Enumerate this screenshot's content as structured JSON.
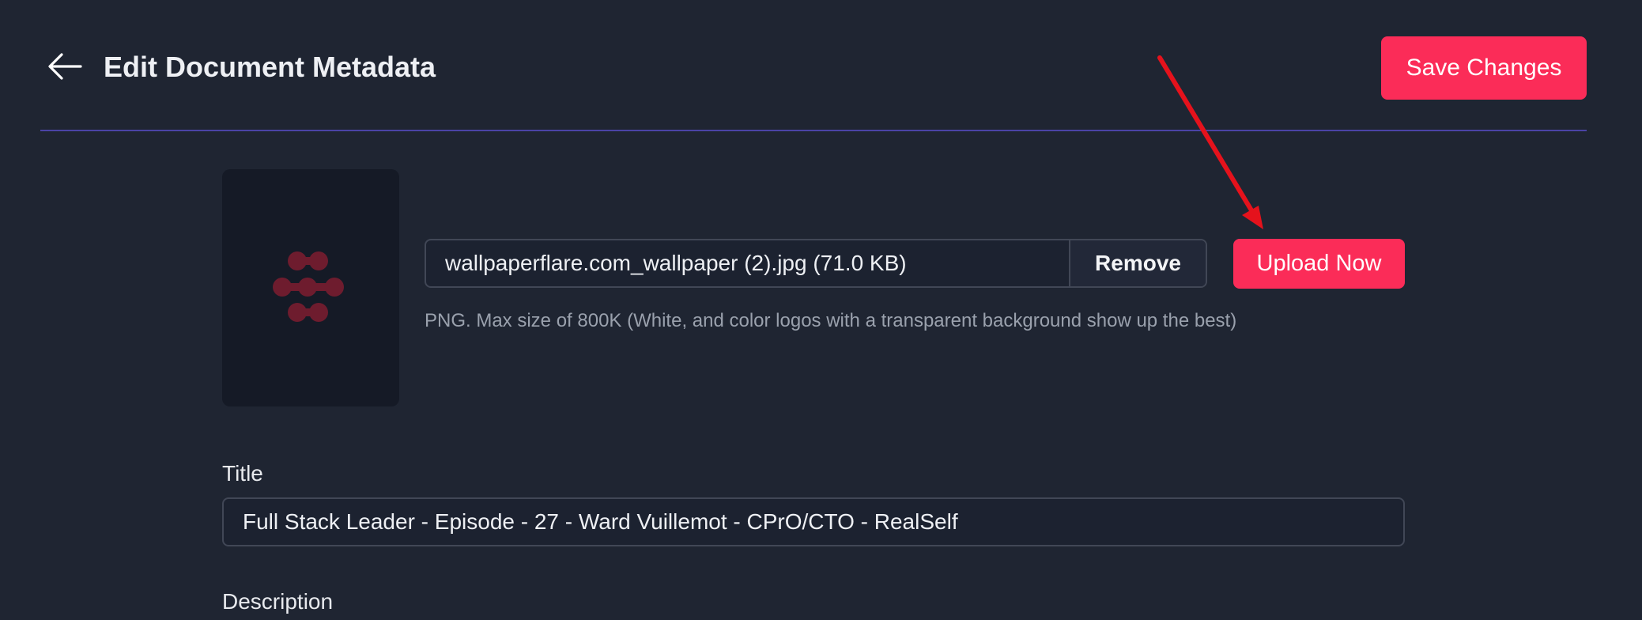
{
  "header": {
    "title": "Edit Document Metadata",
    "save_label": "Save Changes"
  },
  "logo_upload": {
    "file_name": "wallpaperflare.com_wallpaper (2).jpg (71.0 KB)",
    "remove_label": "Remove",
    "upload_label": "Upload Now",
    "hint": "PNG. Max size of 800K (White, and color logos with a transparent background show up the best)"
  },
  "fields": {
    "title_label": "Title",
    "title_value": "Full Stack Leader - Episode - 27 - Ward Vuillemot - CPrO/CTO - RealSelf",
    "description_label": "Description"
  },
  "colors": {
    "accent": "#fb2c58",
    "background": "#1f2532",
    "divider": "#4b43a6",
    "annotation": "#e5121c"
  },
  "icons": {
    "back": "arrow-left-icon",
    "logo": "logo-mark-icon",
    "annotation": "red-arrow-annotation"
  }
}
